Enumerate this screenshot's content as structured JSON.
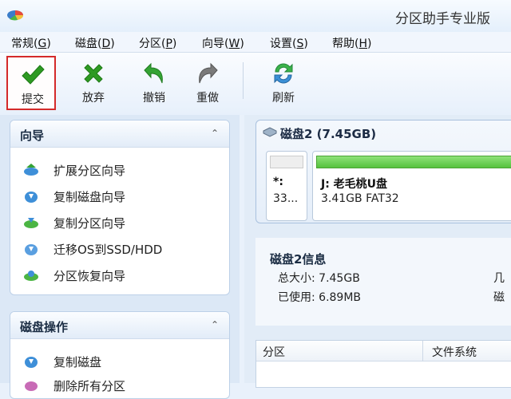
{
  "window": {
    "app_title": "分区助手专业版",
    "app_icon": "partition-app-icon"
  },
  "menu": [
    {
      "label": "常规(",
      "key": "G",
      "tail": ")"
    },
    {
      "label": "磁盘(",
      "key": "D",
      "tail": ")"
    },
    {
      "label": "分区(",
      "key": "P",
      "tail": ")"
    },
    {
      "label": "向导(",
      "key": "W",
      "tail": ")"
    },
    {
      "label": "设置(",
      "key": "S",
      "tail": ")"
    },
    {
      "label": "帮助(",
      "key": "H",
      "tail": ")"
    }
  ],
  "toolbar": {
    "commit": {
      "label": "提交",
      "icon": "green-check-icon",
      "color": "#2e9a23"
    },
    "discard": {
      "label": "放弃",
      "icon": "green-x-icon",
      "color": "#2e9a23"
    },
    "undo": {
      "label": "撤销",
      "icon": "undo-arrow-icon",
      "color": "#34a334"
    },
    "redo": {
      "label": "重做",
      "icon": "redo-arrow-icon",
      "color": "#7a7a7a"
    },
    "refresh": {
      "label": "刷新",
      "icon": "refresh-icon",
      "color": "#3bb24a"
    }
  },
  "wizard_panel": {
    "title": "向导",
    "items": [
      {
        "label": "扩展分区向导",
        "icon": "extend-partition-icon"
      },
      {
        "label": "复制磁盘向导",
        "icon": "copy-disk-icon"
      },
      {
        "label": "复制分区向导",
        "icon": "copy-partition-icon"
      },
      {
        "label": "迁移OS到SSD/HDD",
        "icon": "migrate-os-icon"
      },
      {
        "label": "分区恢复向导",
        "icon": "partition-recovery-icon"
      }
    ]
  },
  "disk_ops_panel": {
    "title": "磁盘操作",
    "items": [
      {
        "label": "复制磁盘",
        "icon": "copy-disk-icon"
      },
      {
        "label": "删除所有分区",
        "icon": "delete-partitions-icon"
      }
    ]
  },
  "disk": {
    "title": "磁盘2 (7.45GB)",
    "partitions": [
      {
        "name": "*:",
        "info": "33...",
        "used_fraction": 0
      },
      {
        "name": "J: 老毛桃U盘",
        "info": "3.41GB FAT32",
        "used_fraction": 1.0
      }
    ]
  },
  "disk_info": {
    "title": "磁盘2信息",
    "total_label": "总大小:",
    "total_value": "7.45GB",
    "used_label": "已使用:",
    "used_value": "6.89MB",
    "right_1": "几",
    "right_2": "磁"
  },
  "table": {
    "columns": [
      "分区",
      "文件系统"
    ]
  }
}
